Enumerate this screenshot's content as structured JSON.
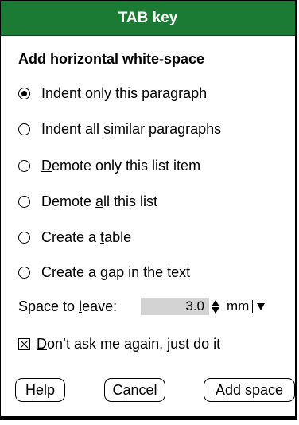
{
  "window": {
    "title": "TAB key"
  },
  "colors": {
    "title_bar": "#1b7a34",
    "title_text": "#ffffff",
    "field_background": "#d3d3d3"
  },
  "heading": "Add horizontal white-space",
  "options": [
    {
      "pre": "",
      "key": "I",
      "post": "ndent only this paragraph",
      "selected": true
    },
    {
      "pre": "Indent all ",
      "key": "s",
      "post": "imilar paragraphs",
      "selected": false
    },
    {
      "pre": "",
      "key": "D",
      "post": "emote only this list item",
      "selected": false
    },
    {
      "pre": "Demote ",
      "key": "a",
      "post": "ll this list",
      "selected": false
    },
    {
      "pre": "Create a ",
      "key": "t",
      "post": "able",
      "selected": false
    },
    {
      "pre": "Create a ",
      "key": "g",
      "post": "ap in the text",
      "selected": false
    }
  ],
  "space": {
    "label_pre": "Space to ",
    "label_key": "l",
    "label_post": "eave:",
    "value": "3.0",
    "unit": "mm"
  },
  "dont_ask": {
    "key": "D",
    "post": "on’t ask me again, just do it",
    "checked": true
  },
  "buttons": {
    "help": {
      "key": "H",
      "post": "elp"
    },
    "cancel": {
      "key": "C",
      "post": "ancel"
    },
    "add": {
      "key": "A",
      "post": "dd space"
    }
  }
}
